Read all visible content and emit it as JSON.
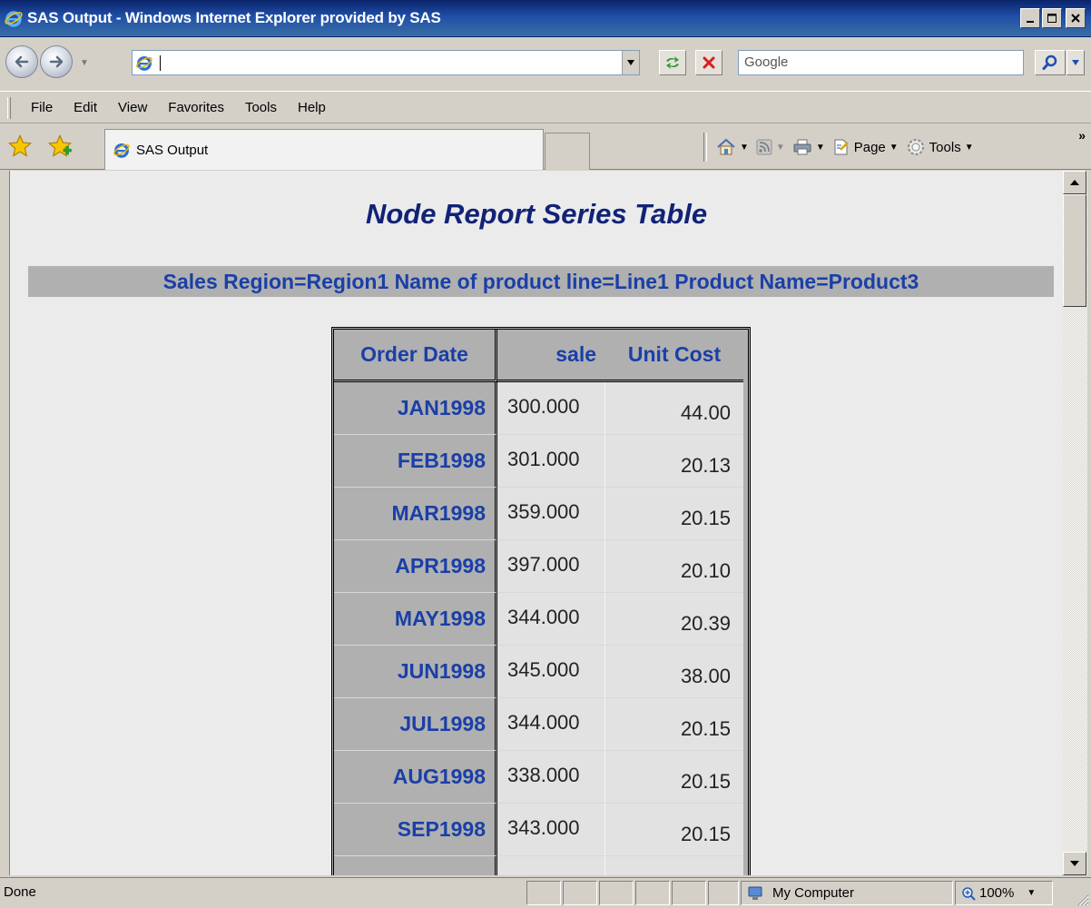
{
  "window": {
    "title": "SAS Output - Windows Internet Explorer provided by SAS"
  },
  "address_bar": {
    "url": "",
    "search_placeholder": "Google"
  },
  "menu": [
    "File",
    "Edit",
    "View",
    "Favorites",
    "Tools",
    "Help"
  ],
  "tab": {
    "label": "SAS Output"
  },
  "command_bar": {
    "page_label": "Page",
    "tools_label": "Tools"
  },
  "report": {
    "title": "Node Report Series Table",
    "byline": "Sales Region=Region1 Name of product line=Line1 Product Name=Product3",
    "columns": [
      "Order Date",
      "sale",
      "Unit Cost"
    ],
    "rows": [
      [
        "JAN1998",
        "300.000",
        "44.00"
      ],
      [
        "FEB1998",
        "301.000",
        "20.13"
      ],
      [
        "MAR1998",
        "359.000",
        "20.15"
      ],
      [
        "APR1998",
        "397.000",
        "20.10"
      ],
      [
        "MAY1998",
        "344.000",
        "20.39"
      ],
      [
        "JUN1998",
        "345.000",
        "38.00"
      ],
      [
        "JUL1998",
        "344.000",
        "20.15"
      ],
      [
        "AUG1998",
        "338.000",
        "20.15"
      ],
      [
        "SEP1998",
        "343.000",
        "20.15"
      ],
      [
        "",
        "",
        ""
      ]
    ]
  },
  "status": {
    "text": "Done",
    "zone": "My Computer",
    "zoom": "100%"
  },
  "colors": {
    "title_blue": "#112277",
    "header_blue": "#1a3fa7",
    "header_gray": "#b0b0b0",
    "cell_gray": "#e2e2e2",
    "page_bg": "#ebebeb"
  }
}
